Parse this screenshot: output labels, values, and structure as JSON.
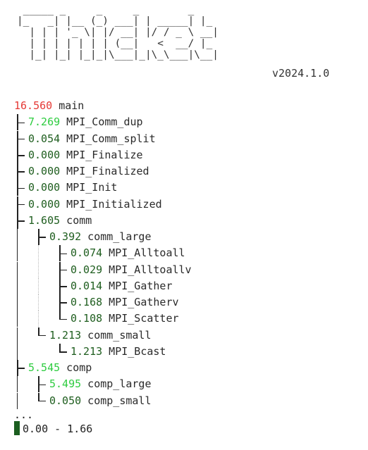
{
  "banner": {
    "ascii_art": " _____ _     _     _        _   \n|_   _| |__ (_) ___| | _____| |_ \n  | | | '_ \\| |/ __| |/ / _ \\ __|\n  | | | | | | | (__|   <  __/ |_ \n  |_| |_| |_|_|\\___|_|\\_\\___|\\__|",
    "version": "v2024.1.0"
  },
  "colors": {
    "root_value": "#e53935",
    "hot_value": "#2ecc40",
    "normal_value": "#1f5e1f",
    "text": "#222222",
    "guide": "#b8b8b8",
    "legend_swatch": "#1b5e20"
  },
  "tree": [
    {
      "depth": 0,
      "value": "16.560",
      "name": "main",
      "tone": "root"
    },
    {
      "depth": 1,
      "value": "7.269",
      "name": "MPI_Comm_dup",
      "tone": "hot",
      "last": false
    },
    {
      "depth": 1,
      "value": "0.054",
      "name": "MPI_Comm_split",
      "tone": "normal",
      "last": false
    },
    {
      "depth": 1,
      "value": "0.000",
      "name": "MPI_Finalize",
      "tone": "normal",
      "last": false
    },
    {
      "depth": 1,
      "value": "0.000",
      "name": "MPI_Finalized",
      "tone": "normal",
      "last": false
    },
    {
      "depth": 1,
      "value": "0.000",
      "name": "MPI_Init",
      "tone": "normal",
      "last": false
    },
    {
      "depth": 1,
      "value": "0.000",
      "name": "MPI_Initialized",
      "tone": "normal",
      "last": false
    },
    {
      "depth": 1,
      "value": "1.605",
      "name": "comm",
      "tone": "normal",
      "last": false
    },
    {
      "depth": 2,
      "value": "0.392",
      "name": "comm_large",
      "tone": "normal",
      "last": false
    },
    {
      "depth": 3,
      "value": "0.074",
      "name": "MPI_Alltoall",
      "tone": "normal",
      "last": false
    },
    {
      "depth": 3,
      "value": "0.029",
      "name": "MPI_Alltoallv",
      "tone": "normal",
      "last": false
    },
    {
      "depth": 3,
      "value": "0.014",
      "name": "MPI_Gather",
      "tone": "normal",
      "last": false
    },
    {
      "depth": 3,
      "value": "0.168",
      "name": "MPI_Gatherv",
      "tone": "normal",
      "last": false
    },
    {
      "depth": 3,
      "value": "0.108",
      "name": "MPI_Scatter",
      "tone": "normal",
      "last": true
    },
    {
      "depth": 2,
      "value": "1.213",
      "name": "comm_small",
      "tone": "normal",
      "last": true
    },
    {
      "depth": 3,
      "value": "1.213",
      "name": "MPI_Bcast",
      "tone": "normal",
      "last": true
    },
    {
      "depth": 1,
      "value": "5.545",
      "name": "comp",
      "tone": "hot",
      "last": false
    },
    {
      "depth": 2,
      "value": "5.495",
      "name": "comp_large",
      "tone": "hot",
      "last": false
    },
    {
      "depth": 2,
      "value": "0.050",
      "name": "comp_small",
      "tone": "normal",
      "last": true
    }
  ],
  "ellipsis": "...",
  "legend": {
    "range": "0.00 - 1.66"
  }
}
